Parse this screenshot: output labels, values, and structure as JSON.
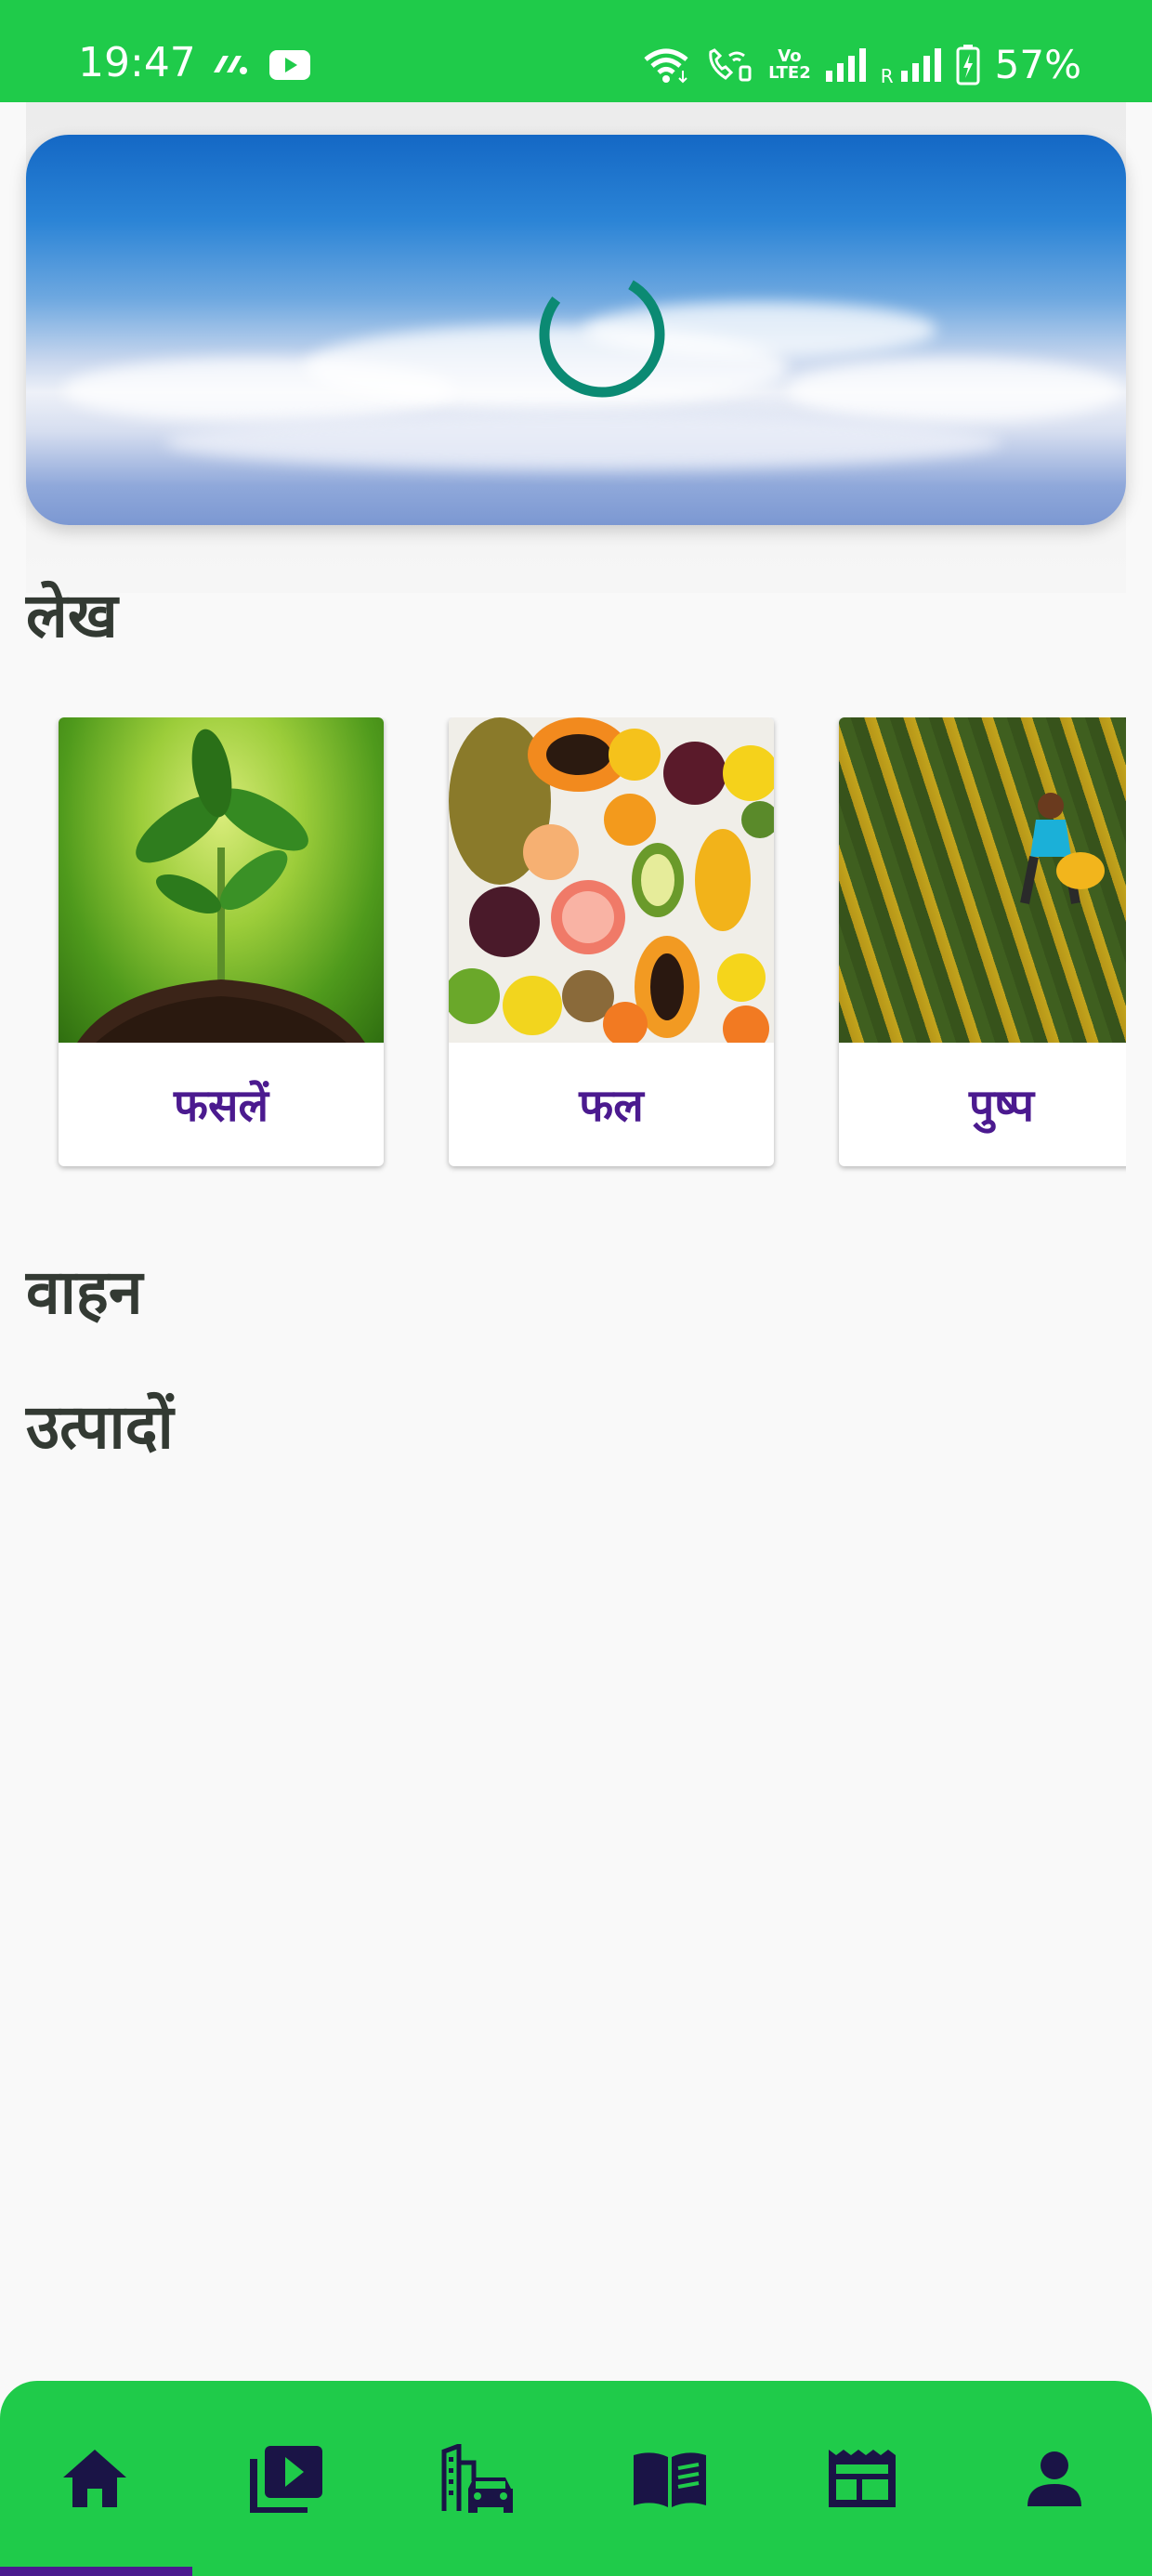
{
  "status_bar": {
    "time": "19:47",
    "battery": "57%",
    "r_label": "R",
    "volte": "Vo\nLTE2",
    "left_icons": [
      "app-icon",
      "youtube-icon"
    ],
    "right_icons": [
      "wifi-icon",
      "wifi-call-icon",
      "volte-icon",
      "signal-icon",
      "roaming-signal-icon",
      "battery-charging-icon"
    ]
  },
  "banner": {
    "loading": true
  },
  "sections": {
    "articles_title": "लेख",
    "vehicles_title": "वाहन",
    "products_title": "उत्पादों"
  },
  "article_cards": [
    {
      "label": "फसलें",
      "image": "plant-seedling-image"
    },
    {
      "label": "फल",
      "image": "fruits-image"
    },
    {
      "label": "पुष्प",
      "image": "flower-field-image"
    }
  ],
  "bottom_nav": {
    "items": [
      "home-icon",
      "video-library-icon",
      "city-car-icon",
      "book-icon",
      "newspaper-icon",
      "person-icon"
    ],
    "active_index": 0
  },
  "colors": {
    "accent_green": "#1fcb4a",
    "purple": "#4b1a8f",
    "spinner": "#0b8a73",
    "title": "#333a33"
  }
}
